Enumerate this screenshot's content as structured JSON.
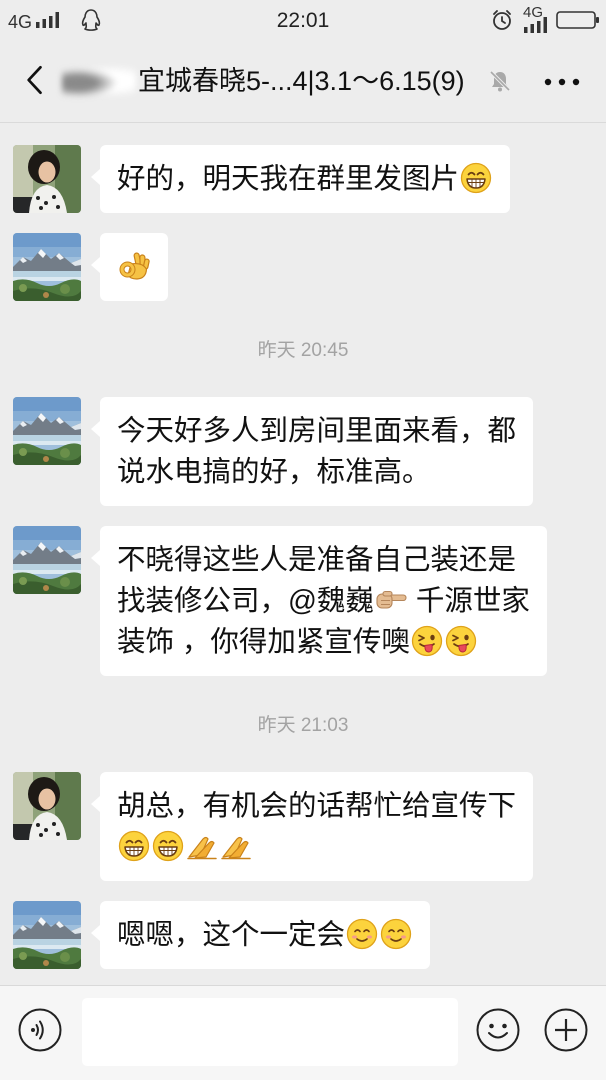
{
  "status_bar": {
    "network_left": "4G",
    "time": "22:01",
    "network_right": "4G",
    "icons": [
      "signal-icon",
      "qq-icon",
      "alarm-icon",
      "signal-icon",
      "battery-icon"
    ]
  },
  "header": {
    "title": "宜城春晓5-...4|3.1～6.15(9)",
    "icons": {
      "back": "back-arrow-icon",
      "status": "mute-bell-icon",
      "more": "more-dots-icon"
    }
  },
  "messages": [
    {
      "kind": "message",
      "avatar": "portrait-avatar",
      "lines": [
        [
          {
            "text": "好的，明天我在群里发图片"
          },
          {
            "emoji": "grin-emoji"
          }
        ]
      ]
    },
    {
      "kind": "message",
      "avatar": "landscape-avatar",
      "lines": [
        [
          {
            "emoji": "ok-hand-emoji"
          }
        ]
      ]
    },
    {
      "kind": "time",
      "text": "昨天 20:45"
    },
    {
      "kind": "message",
      "avatar": "landscape-avatar",
      "lines": [
        [
          {
            "text": "今天好多人到房间里面来看，都"
          }
        ],
        [
          {
            "text": "说水电搞的好，标准高。"
          }
        ]
      ]
    },
    {
      "kind": "message",
      "avatar": "landscape-avatar",
      "lines": [
        [
          {
            "text": "不晓得这些人是准备自己装还是"
          }
        ],
        [
          {
            "text": "找装修公司，@魏巍"
          },
          {
            "emoji": "point-right-emoji"
          },
          {
            "text": " 千源世家"
          }
        ],
        [
          {
            "text": "装饰 ，你得加紧宣传噢"
          },
          {
            "emoji": "wink-tongue-emoji"
          },
          {
            "emoji": "wink-tongue-emoji"
          }
        ]
      ]
    },
    {
      "kind": "time",
      "text": "昨天 21:03"
    },
    {
      "kind": "message",
      "avatar": "portrait-avatar",
      "lines": [
        [
          {
            "text": "胡总，有机会的话帮忙给宣传下"
          }
        ],
        [
          {
            "emoji": "grin-emoji"
          },
          {
            "emoji": "grin-emoji"
          },
          {
            "emoji": "folded-hands-emoji"
          },
          {
            "emoji": "folded-hands-emoji"
          }
        ]
      ]
    },
    {
      "kind": "message",
      "avatar": "landscape-avatar",
      "lines": [
        [
          {
            "text": "嗯嗯，这个一定会"
          },
          {
            "emoji": "smile-emoji"
          },
          {
            "emoji": "smile-emoji"
          }
        ]
      ]
    }
  ],
  "input_bar": {
    "value": "",
    "icons": {
      "voice": "voice-icon",
      "emoji": "emoji-face-icon",
      "plus": "plus-icon"
    }
  },
  "colors": {
    "background": "#ededed",
    "bubble": "#ffffff",
    "text": "#111111",
    "timestamp": "#a3a3a3",
    "input_bar": "#f6f6f6"
  }
}
